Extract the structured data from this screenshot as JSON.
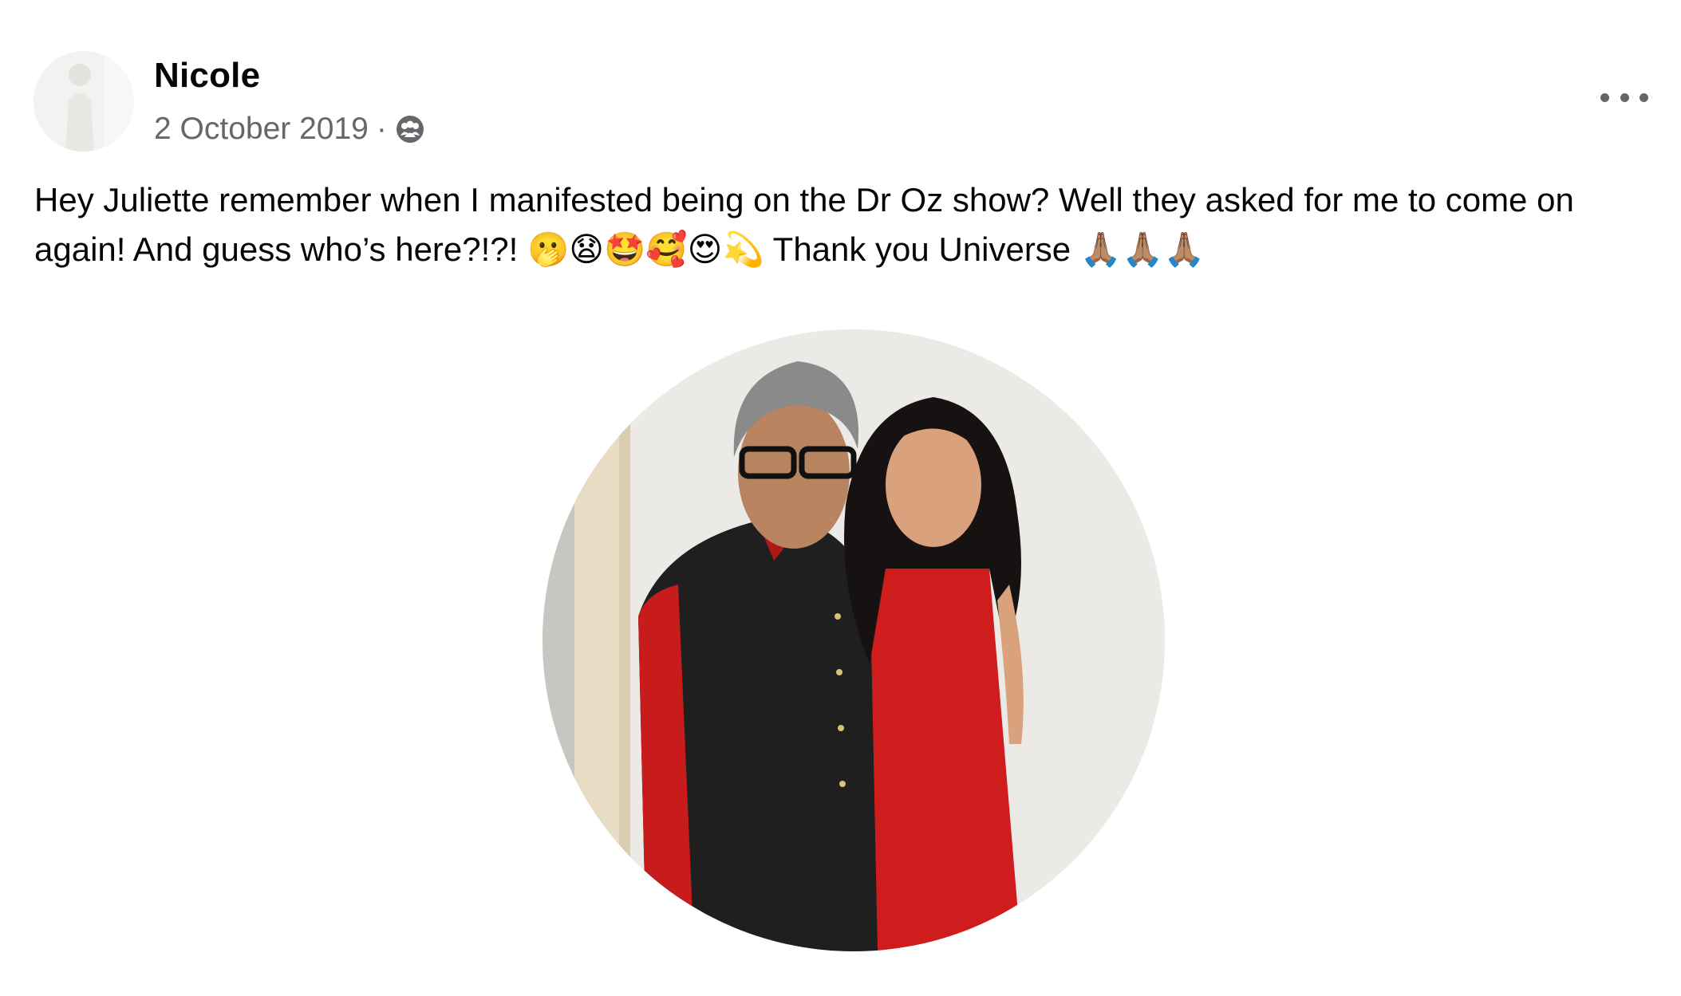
{
  "post": {
    "author": "Nicole",
    "date": "2 October 2019",
    "separator": "·",
    "audience_icon": "friends-icon",
    "more_icon": "more-options-icon",
    "text": "Hey Juliette remember when I manifested being on the Dr Oz show? Well they asked for me to come on again! And guess who’s here?!?! 🫢😧🤩🥰😍💫 Thank you Universe 🙏🏽🙏🏽🙏🏽"
  }
}
